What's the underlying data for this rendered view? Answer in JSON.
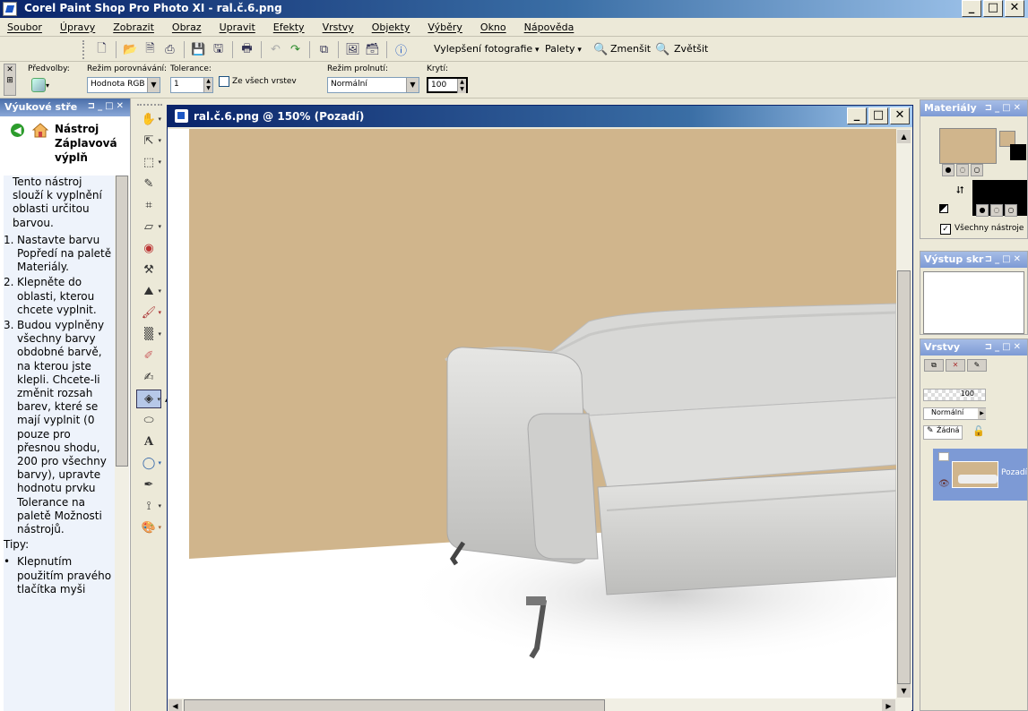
{
  "window": {
    "title": "Corel Paint Shop Pro Photo XI - ral.č.6.png"
  },
  "menu": [
    "Soubor",
    "Úpravy",
    "Zobrazit",
    "Obraz",
    "Upravit",
    "Efekty",
    "Vrstvy",
    "Objekty",
    "Výběry",
    "Okno",
    "Nápověda"
  ],
  "toolbar": {
    "photo_fix": "Vylepšení fotografie",
    "palettes": "Palety",
    "zoom_out": "Zmenšit",
    "zoom_in": "Zvětšit"
  },
  "options": {
    "presets_label": "Předvolby:",
    "match_mode_label": "Režim porovnávání:",
    "match_mode_value": "Hodnota RGB",
    "tolerance_label": "Tolerance:",
    "tolerance_value": "1",
    "all_layers_label": "Ze všech vrstev",
    "blend_mode_label": "Režim prolnutí:",
    "blend_mode_value": "Normální",
    "opacity_label": "Krytí:",
    "opacity_value": "100"
  },
  "learning": {
    "panel_title": "Výukové stře",
    "tool_title": "Nástroj Záplavová výplň",
    "intro": "Tento nástroj slouží k vyplnění oblasti určitou barvou.",
    "steps": [
      {
        "num": "1.",
        "text": "Nastavte barvu Popředí na paletě Materiály."
      },
      {
        "num": "2.",
        "text": "Klepněte do oblasti, kterou chcete vyplnit."
      },
      {
        "num": "3.",
        "text": "Budou vyplněny všechny barvy obdobné barvě, na kterou jste klepli. Chcete-li změnit rozsah barev, které se mají vyplnit (0 pouze pro přesnou shodu, 200 pro všechny barvy), upravte hodnotu prvku Tolerance na paletě Možnosti nástrojů."
      }
    ],
    "tips_label": "Tipy:",
    "tip": "Klepnutím použitím pravého tlačítka myši"
  },
  "document": {
    "title": "ral.č.6.png @ 150% (Pozadí)"
  },
  "materials": {
    "panel_title": "Materiály",
    "all_tools_label": "Všechny nástroje",
    "foreground_color": "#d0b58c",
    "background_color": "#000000"
  },
  "script_output": {
    "panel_title": "Výstup skr"
  },
  "layers": {
    "panel_title": "Vrstvy",
    "opacity": "100",
    "blend_mode": "Normální",
    "mask": "Žádná",
    "layer_name": "Pozadí"
  },
  "colors": {
    "wall": "#d0b58c",
    "accent": "#0a246a",
    "selection": "#7d9ad5"
  }
}
